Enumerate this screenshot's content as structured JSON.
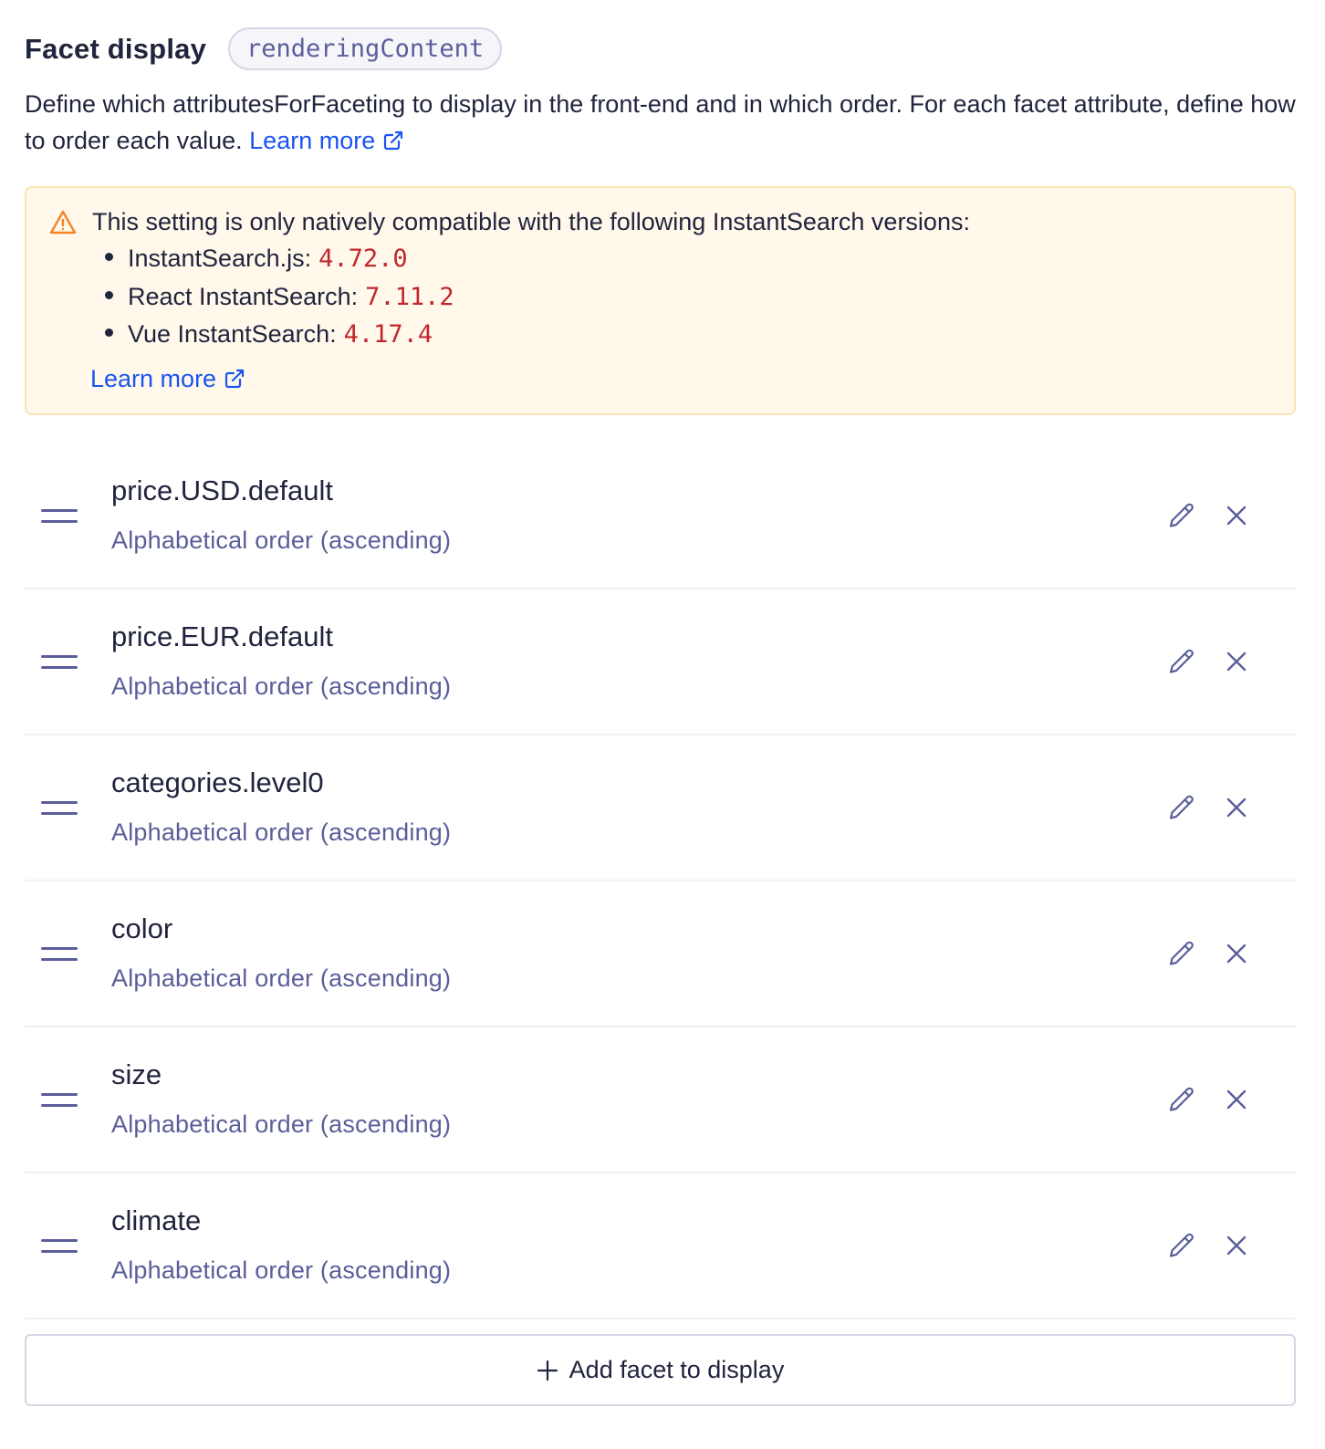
{
  "header": {
    "title": "Facet display",
    "tag": "renderingContent"
  },
  "description": {
    "text": "Define which attributesForFaceting to display in the front-end and in which order. For each facet attribute, define how to order each value. ",
    "link": "Learn more"
  },
  "warning": {
    "text": "This setting is only natively compatible with the following InstantSearch versions:",
    "versions": [
      {
        "name": "InstantSearch.js:",
        "version": "4.72.0"
      },
      {
        "name": "React InstantSearch:",
        "version": "7.11.2"
      },
      {
        "name": "Vue InstantSearch:",
        "version": "4.17.4"
      }
    ],
    "link": "Learn more"
  },
  "facets": [
    {
      "name": "price.USD.default",
      "order": "Alphabetical order (ascending)"
    },
    {
      "name": "price.EUR.default",
      "order": "Alphabetical order (ascending)"
    },
    {
      "name": "categories.level0",
      "order": "Alphabetical order (ascending)"
    },
    {
      "name": "color",
      "order": "Alphabetical order (ascending)"
    },
    {
      "name": "size",
      "order": "Alphabetical order (ascending)"
    },
    {
      "name": "climate",
      "order": "Alphabetical order (ascending)"
    }
  ],
  "add_button": {
    "label": "Add facet to display"
  },
  "colors": {
    "accent_link": "#1a53f0",
    "warning_bg": "#fff8eb",
    "warning_icon": "#f78125",
    "code": "#c1272d",
    "muted": "#5a5e9a"
  },
  "icons": {
    "drag": "drag-handle-icon",
    "edit": "pencil-icon",
    "remove": "close-icon",
    "warning": "warning-triangle-icon",
    "external": "external-link-icon",
    "add": "plus-icon"
  }
}
